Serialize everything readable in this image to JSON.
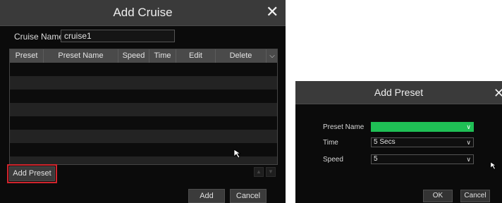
{
  "add_cruise": {
    "title": "Add Cruise",
    "close_glyph": "✕",
    "cruise_name": {
      "label": "Cruise Name",
      "value": "cruise1"
    },
    "table": {
      "columns": [
        "Preset",
        "Preset Name",
        "Speed",
        "Time",
        "Edit",
        "Delete"
      ],
      "header_menu_icon": "chevron-down-icon",
      "rows": []
    },
    "add_preset_label": "Add Preset",
    "move_up_icon": "arrow-up-icon",
    "move_down_icon": "arrow-down-icon",
    "add_label": "Add",
    "cancel_label": "Cancel",
    "highlight_color": "#d0242c"
  },
  "add_preset": {
    "title": "Add Preset",
    "close_glyph": "✕",
    "preset_name": {
      "label": "Preset Name",
      "value": ""
    },
    "time": {
      "label": "Time",
      "value": "5 Secs"
    },
    "speed": {
      "label": "Speed",
      "value": "5"
    },
    "ok_label": "OK",
    "cancel_label": "Cancel",
    "accent_color": "#1fbf55"
  }
}
